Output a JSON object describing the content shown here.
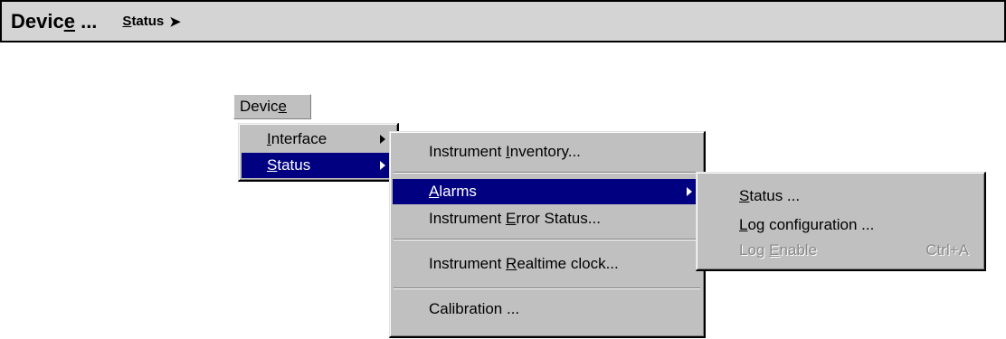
{
  "header": {
    "title_prefix": "Devic",
    "title_ul": "e",
    "title_suffix": " ...",
    "sub_ul": "S",
    "sub_rest": "tatus",
    "arrow": "➤"
  },
  "menu_bar": {
    "title_prefix": "Devic",
    "title_ul": "e"
  },
  "device_menu": {
    "items": [
      {
        "ul": "I",
        "rest": "nterface",
        "has_submenu": true
      },
      {
        "ul": "S",
        "rest": "tatus",
        "has_submenu": true,
        "selected": true
      }
    ]
  },
  "status_menu": {
    "items": [
      {
        "prefix": "Instrument ",
        "ul": "I",
        "rest": "nventory..."
      },
      {
        "prefix": "",
        "ul": "A",
        "rest": "larms",
        "has_submenu": true,
        "selected": true
      },
      {
        "prefix": "Instrument ",
        "ul": "E",
        "rest": "rror Status..."
      },
      {
        "prefix": "Instrument ",
        "ul": "R",
        "rest": "ealtime clock..."
      },
      {
        "prefix": "Calibration ...",
        "ul": "",
        "rest": ""
      }
    ]
  },
  "alarms_menu": {
    "items": [
      {
        "ul": "S",
        "rest": "tatus ..."
      },
      {
        "ul": "L",
        "rest": "og configuration ..."
      },
      {
        "pre": "Log ",
        "ul": "E",
        "rest": "nable",
        "shortcut": "Ctrl+A",
        "disabled": true
      }
    ]
  },
  "colors": {
    "menu_bg": "#c0c0c0",
    "highlight": "#000080",
    "disabled_text": "#8a8a8a"
  }
}
